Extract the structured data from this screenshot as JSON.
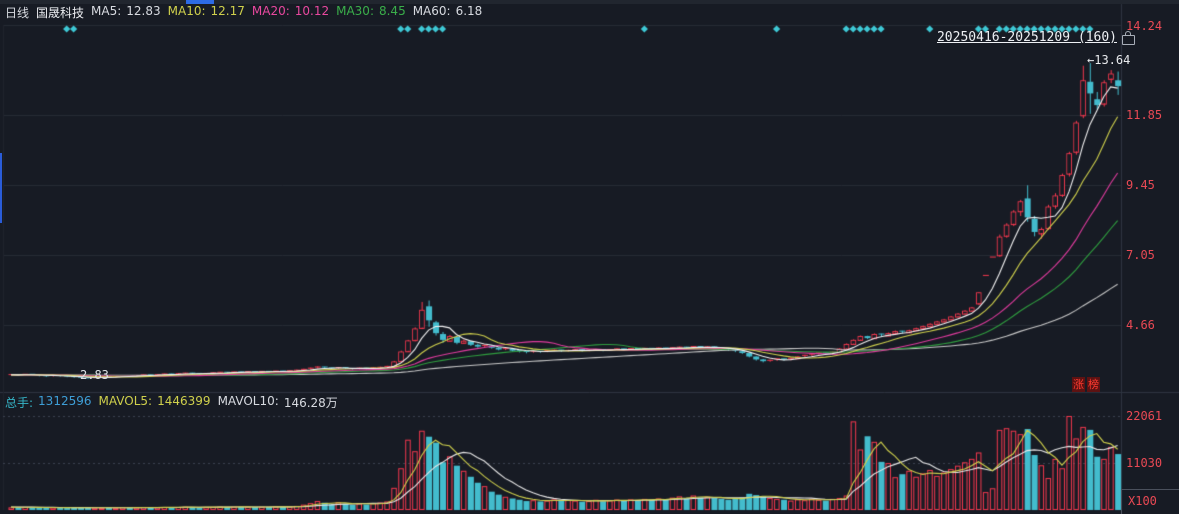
{
  "header": {
    "period": "日线",
    "stock_name": "国晟科技",
    "ma_items": [
      {
        "label": "MA5:",
        "value": "12.83",
        "color": "#d7dae0"
      },
      {
        "label": "MA10:",
        "value": "12.17",
        "color": "#cfd04c"
      },
      {
        "label": "MA20:",
        "value": "10.12",
        "color": "#e8489f"
      },
      {
        "label": "MA30:",
        "value": "8.45",
        "color": "#3aae4a"
      },
      {
        "label": "MA60:",
        "value": "6.18",
        "color": "#d7dae0"
      }
    ]
  },
  "toolbar": {
    "date_range": "20250416-20251209 (160)"
  },
  "annotations": {
    "high_arrow": "←",
    "high_label": "13.64",
    "low_label": "2.83",
    "badge_char1": "涨",
    "badge_char2": "榜"
  },
  "price_axis": {
    "labels": [
      "14.24",
      "11.85",
      "9.45",
      "7.05",
      "4.66"
    ]
  },
  "volume_header": {
    "vol_label": "总手:",
    "vol_value": "1312596",
    "mavol5_label": "MAVOL5:",
    "mavol5_value": "1446399",
    "mavol10_label": "MAVOL10:",
    "mavol10_value": "146.28万"
  },
  "volume_axis": {
    "labels": [
      "22061",
      "11030"
    ],
    "unit": "X100"
  },
  "colors": {
    "background": "#171b24",
    "grid": "#262b35",
    "grid_dotted": "#3c4250",
    "frame": "#2e3440",
    "up": "#f5384e",
    "down": "#43bccd",
    "signal": "#3ec9d6",
    "ma5": "#f2f2f2",
    "ma10": "#cfd04c",
    "ma20": "#e03b9e",
    "ma30": "#2f9e3f",
    "ma60": "#c9c9c9",
    "mavol5": "#cfd04c",
    "mavol10": "#e8e8e8",
    "axis_text": "#e94954",
    "accent_blue": "#2d6be5",
    "badge_bg": "#5d1212",
    "badge_text": "#ff3b30"
  },
  "chart_data": {
    "type": "candlestick",
    "title": "国晟科技 日线",
    "date_range": "20250416-20251209",
    "bar_count": 160,
    "price_gridlines": [
      14.24,
      11.85,
      9.45,
      7.05,
      4.66
    ],
    "volume_gridlines": [
      22061,
      11030
    ],
    "volume_unit": "X100",
    "marked_high": 13.64,
    "marked_low": 2.83,
    "marked_low_day": 11,
    "marked_high_day": 155,
    "ma_periods": [
      5,
      10,
      20,
      30,
      60
    ],
    "mavol_periods": [
      5,
      10
    ],
    "history_seed_close": 2.95,
    "history_seed_volume": 700,
    "signal_days": [
      8,
      9,
      56,
      57,
      59,
      60,
      61,
      62,
      91,
      110,
      120,
      121,
      122,
      123,
      124,
      125,
      132,
      139,
      140,
      142,
      143,
      144,
      145,
      146,
      147,
      148,
      149,
      150,
      151,
      152,
      153,
      154,
      155
    ],
    "candles": [
      [
        2.95,
        2.98,
        2.93,
        2.96
      ],
      [
        2.96,
        2.97,
        2.92,
        2.94
      ],
      [
        2.94,
        2.98,
        2.93,
        2.97
      ],
      [
        2.97,
        2.98,
        2.93,
        2.95
      ],
      [
        2.95,
        2.96,
        2.9,
        2.92
      ],
      [
        2.92,
        2.94,
        2.88,
        2.9
      ],
      [
        2.9,
        2.94,
        2.89,
        2.93
      ],
      [
        2.93,
        2.94,
        2.89,
        2.91
      ],
      [
        2.91,
        2.92,
        2.87,
        2.89
      ],
      [
        2.89,
        2.9,
        2.85,
        2.87
      ],
      [
        2.87,
        2.88,
        2.84,
        2.85
      ],
      [
        2.85,
        2.86,
        2.83,
        2.84
      ],
      [
        2.84,
        2.87,
        2.83,
        2.86
      ],
      [
        2.86,
        2.89,
        2.85,
        2.88
      ],
      [
        2.88,
        2.89,
        2.85,
        2.87
      ],
      [
        2.87,
        2.91,
        2.86,
        2.9
      ],
      [
        2.9,
        2.93,
        2.89,
        2.92
      ],
      [
        2.92,
        2.93,
        2.89,
        2.91
      ],
      [
        2.91,
        2.94,
        2.9,
        2.93
      ],
      [
        2.93,
        2.96,
        2.92,
        2.95
      ],
      [
        2.95,
        2.96,
        2.92,
        2.94
      ],
      [
        2.94,
        2.97,
        2.93,
        2.96
      ],
      [
        2.96,
        2.99,
        2.95,
        2.98
      ],
      [
        2.98,
        2.99,
        2.95,
        2.97
      ],
      [
        2.97,
        3.0,
        2.96,
        2.99
      ],
      [
        2.99,
        3.02,
        2.98,
        3.01
      ],
      [
        3.01,
        3.02,
        2.98,
        3.0
      ],
      [
        3.0,
        3.01,
        2.96,
        2.98
      ],
      [
        2.98,
        3.01,
        2.97,
        3.0
      ],
      [
        3.0,
        3.03,
        2.99,
        3.02
      ],
      [
        3.02,
        3.05,
        3.01,
        3.04
      ],
      [
        3.04,
        3.05,
        3.01,
        3.03
      ],
      [
        3.03,
        3.06,
        3.02,
        3.05
      ],
      [
        3.05,
        3.06,
        3.02,
        3.04
      ],
      [
        3.04,
        3.07,
        3.03,
        3.06
      ],
      [
        3.06,
        3.07,
        3.03,
        3.05
      ],
      [
        3.05,
        3.08,
        3.04,
        3.07
      ],
      [
        3.07,
        3.08,
        3.04,
        3.06
      ],
      [
        3.06,
        3.09,
        3.05,
        3.08
      ],
      [
        3.08,
        3.09,
        3.05,
        3.07
      ],
      [
        3.07,
        3.1,
        3.06,
        3.09
      ],
      [
        3.09,
        3.13,
        3.08,
        3.11
      ],
      [
        3.11,
        3.16,
        3.1,
        3.14
      ],
      [
        3.14,
        3.2,
        3.13,
        3.18
      ],
      [
        3.18,
        3.24,
        3.17,
        3.22
      ],
      [
        3.22,
        3.23,
        3.17,
        3.19
      ],
      [
        3.19,
        3.2,
        3.14,
        3.16
      ],
      [
        3.16,
        3.22,
        3.15,
        3.2
      ],
      [
        3.2,
        3.21,
        3.15,
        3.17
      ],
      [
        3.17,
        3.18,
        3.13,
        3.15
      ],
      [
        3.15,
        3.2,
        3.14,
        3.18
      ],
      [
        3.18,
        3.19,
        3.14,
        3.16
      ],
      [
        3.16,
        3.21,
        3.15,
        3.19
      ],
      [
        3.19,
        3.23,
        3.18,
        3.21
      ],
      [
        3.21,
        3.26,
        3.2,
        3.24
      ],
      [
        3.24,
        3.43,
        3.23,
        3.41
      ],
      [
        3.42,
        3.78,
        3.4,
        3.75
      ],
      [
        3.76,
        4.15,
        3.74,
        4.13
      ],
      [
        4.14,
        4.58,
        4.1,
        4.54
      ],
      [
        4.56,
        5.45,
        4.52,
        5.18
      ],
      [
        5.3,
        5.5,
        4.6,
        4.82
      ],
      [
        4.75,
        4.8,
        4.3,
        4.38
      ],
      [
        4.35,
        4.42,
        4.05,
        4.15
      ],
      [
        4.12,
        4.32,
        4.1,
        4.28
      ],
      [
        4.25,
        4.27,
        4.0,
        4.05
      ],
      [
        4.05,
        4.16,
        4.02,
        4.12
      ],
      [
        4.1,
        4.12,
        3.94,
        3.98
      ],
      [
        3.98,
        4.02,
        3.88,
        3.92
      ],
      [
        3.92,
        3.99,
        3.9,
        3.96
      ],
      [
        3.95,
        3.97,
        3.85,
        3.88
      ],
      [
        3.88,
        3.9,
        3.79,
        3.82
      ],
      [
        3.82,
        3.88,
        3.8,
        3.85
      ],
      [
        3.84,
        3.86,
        3.75,
        3.78
      ],
      [
        3.78,
        3.8,
        3.72,
        3.75
      ],
      [
        3.75,
        3.77,
        3.69,
        3.72
      ],
      [
        3.72,
        3.78,
        3.71,
        3.76
      ],
      [
        3.76,
        3.77,
        3.71,
        3.74
      ],
      [
        3.74,
        3.8,
        3.73,
        3.78
      ],
      [
        3.78,
        3.82,
        3.76,
        3.8
      ],
      [
        3.8,
        3.81,
        3.74,
        3.77
      ],
      [
        3.77,
        3.81,
        3.75,
        3.79
      ],
      [
        3.79,
        3.83,
        3.77,
        3.81
      ],
      [
        3.81,
        3.82,
        3.75,
        3.78
      ],
      [
        3.78,
        3.82,
        3.76,
        3.8
      ],
      [
        3.8,
        3.84,
        3.78,
        3.82
      ],
      [
        3.82,
        3.83,
        3.76,
        3.79
      ],
      [
        3.79,
        3.83,
        3.77,
        3.81
      ],
      [
        3.81,
        3.86,
        3.8,
        3.84
      ],
      [
        3.84,
        3.85,
        3.79,
        3.82
      ],
      [
        3.82,
        3.87,
        3.81,
        3.85
      ],
      [
        3.85,
        3.86,
        3.8,
        3.83
      ],
      [
        3.83,
        3.88,
        3.82,
        3.86
      ],
      [
        3.86,
        3.87,
        3.81,
        3.84
      ],
      [
        3.84,
        3.89,
        3.83,
        3.87
      ],
      [
        3.87,
        3.88,
        3.82,
        3.85
      ],
      [
        3.85,
        3.9,
        3.84,
        3.88
      ],
      [
        3.88,
        3.92,
        3.86,
        3.9
      ],
      [
        3.9,
        3.91,
        3.84,
        3.87
      ],
      [
        3.87,
        3.94,
        3.86,
        3.92
      ],
      [
        3.92,
        3.93,
        3.86,
        3.89
      ],
      [
        3.89,
        3.93,
        3.87,
        3.91
      ],
      [
        3.91,
        3.92,
        3.85,
        3.88
      ],
      [
        3.88,
        3.89,
        3.82,
        3.85
      ],
      [
        3.85,
        3.86,
        3.77,
        3.8
      ],
      [
        3.8,
        3.81,
        3.73,
        3.76
      ],
      [
        3.76,
        3.77,
        3.67,
        3.7
      ],
      [
        3.7,
        3.71,
        3.55,
        3.58
      ],
      [
        3.58,
        3.59,
        3.44,
        3.48
      ],
      [
        3.48,
        3.5,
        3.38,
        3.42
      ],
      [
        3.42,
        3.47,
        3.4,
        3.45
      ],
      [
        3.45,
        3.52,
        3.43,
        3.5
      ],
      [
        3.5,
        3.51,
        3.44,
        3.47
      ],
      [
        3.47,
        3.54,
        3.45,
        3.52
      ],
      [
        3.52,
        3.6,
        3.5,
        3.58
      ],
      [
        3.58,
        3.64,
        3.56,
        3.62
      ],
      [
        3.62,
        3.68,
        3.6,
        3.66
      ],
      [
        3.66,
        3.72,
        3.64,
        3.7
      ],
      [
        3.7,
        3.71,
        3.65,
        3.68
      ],
      [
        3.68,
        3.75,
        3.66,
        3.73
      ],
      [
        3.73,
        3.87,
        3.72,
        3.85
      ],
      [
        3.85,
        4.03,
        3.84,
        4.01
      ],
      [
        4.01,
        4.17,
        4.0,
        4.15
      ],
      [
        4.15,
        4.3,
        4.13,
        4.28
      ],
      [
        4.28,
        4.29,
        4.18,
        4.21
      ],
      [
        4.21,
        4.37,
        4.2,
        4.35
      ],
      [
        4.35,
        4.36,
        4.26,
        4.3
      ],
      [
        4.3,
        4.4,
        4.28,
        4.38
      ],
      [
        4.38,
        4.47,
        4.36,
        4.45
      ],
      [
        4.45,
        4.46,
        4.37,
        4.41
      ],
      [
        4.41,
        4.5,
        4.39,
        4.48
      ],
      [
        4.48,
        4.57,
        4.46,
        4.55
      ],
      [
        4.55,
        4.64,
        4.53,
        4.62
      ],
      [
        4.62,
        4.72,
        4.6,
        4.7
      ],
      [
        4.7,
        4.8,
        4.68,
        4.78
      ],
      [
        4.78,
        4.87,
        4.76,
        4.85
      ],
      [
        4.85,
        4.97,
        4.83,
        4.95
      ],
      [
        4.95,
        5.07,
        4.93,
        5.05
      ],
      [
        5.05,
        5.17,
        5.03,
        5.15
      ],
      [
        5.15,
        5.28,
        5.13,
        5.26
      ],
      [
        5.4,
        5.78,
        5.35,
        5.78
      ],
      [
        6.36,
        6.36,
        6.36,
        6.36
      ],
      [
        6.99,
        6.99,
        6.99,
        6.99
      ],
      [
        7.05,
        7.76,
        7.0,
        7.69
      ],
      [
        7.72,
        8.15,
        7.65,
        8.1
      ],
      [
        8.12,
        8.6,
        8.05,
        8.55
      ],
      [
        8.56,
        8.95,
        8.4,
        8.9
      ],
      [
        9.0,
        9.45,
        8.2,
        8.35
      ],
      [
        8.3,
        8.4,
        7.7,
        7.85
      ],
      [
        7.8,
        8.0,
        7.62,
        7.95
      ],
      [
        7.98,
        8.78,
        7.92,
        8.72
      ],
      [
        8.75,
        9.18,
        8.65,
        9.1
      ],
      [
        9.12,
        9.85,
        9.05,
        9.8
      ],
      [
        9.85,
        10.6,
        9.75,
        10.55
      ],
      [
        10.6,
        11.66,
        10.5,
        11.6
      ],
      [
        11.85,
        13.55,
        11.75,
        13.05
      ],
      [
        13.0,
        13.64,
        11.9,
        12.6
      ],
      [
        12.4,
        12.65,
        12.05,
        12.2
      ],
      [
        12.25,
        13.05,
        12.15,
        12.98
      ],
      [
        13.1,
        13.4,
        12.95,
        13.28
      ],
      [
        13.05,
        13.35,
        12.55,
        12.85
      ]
    ],
    "volumes": [
      620,
      580,
      700,
      540,
      610,
      480,
      560,
      520,
      590,
      470,
      500,
      640,
      520,
      480,
      560,
      500,
      620,
      540,
      580,
      640,
      560,
      600,
      680,
      620,
      700,
      750,
      660,
      580,
      640,
      720,
      780,
      700,
      760,
      690,
      740,
      680,
      730,
      710,
      770,
      720,
      780,
      950,
      1250,
      1600,
      2100,
      1700,
      1350,
      1800,
      1450,
      1200,
      1500,
      1300,
      1600,
      1750,
      2000,
      5200,
      9800,
      16500,
      13800,
      18600,
      17200,
      15800,
      11200,
      12600,
      10400,
      9200,
      7800,
      6400,
      5600,
      4300,
      3600,
      3100,
      2700,
      2400,
      2100,
      2300,
      2000,
      2200,
      2500,
      2150,
      2350,
      2200,
      1950,
      2100,
      2400,
      2050,
      2250,
      2450,
      2150,
      2500,
      2300,
      2600,
      2350,
      2700,
      2450,
      2900,
      3200,
      2750,
      3400,
      2950,
      3100,
      2800,
      2600,
      2400,
      2700,
      2900,
      3800,
      3500,
      3200,
      2800,
      2600,
      2400,
      2200,
      2500,
      2300,
      2600,
      2400,
      2200,
      2600,
      2800,
      3400,
      20800,
      14200,
      17300,
      16000,
      11300,
      11000,
      7700,
      8400,
      9200,
      7800,
      8600,
      9400,
      8000,
      8800,
      9600,
      10400,
      11200,
      12000,
      13500,
      4200,
      5100,
      18800,
      19200,
      18600,
      17800,
      19000,
      12900,
      10500,
      7500,
      12000,
      9800,
      22061,
      16800,
      19500,
      18800,
      12500,
      12000,
      14800,
      13126
    ]
  }
}
